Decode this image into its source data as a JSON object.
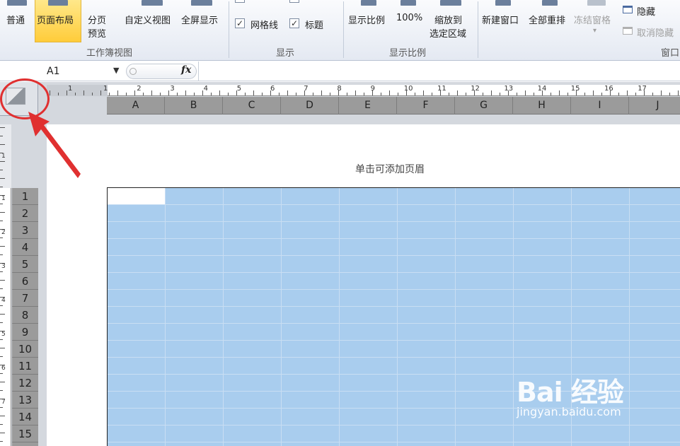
{
  "ribbon": {
    "view_group": {
      "normal": "普通",
      "page_layout": "页面布局",
      "page_break_line1": "分页",
      "page_break_line2": "预览",
      "custom_view": "自定义视图",
      "full_screen": "全屏显示",
      "label": "工作簿视图"
    },
    "show_group": {
      "gridlines": "网格线",
      "gridlines_checked": true,
      "headings": "标题",
      "headings_checked": true,
      "label": "显示"
    },
    "zoom_group": {
      "zoom": "显示比例",
      "zoom_100": "100%",
      "zoom_to_selection_line1": "缩放到",
      "zoom_to_selection_line2": "选定区域",
      "label": "显示比例"
    },
    "window_group": {
      "new_window": "新建窗口",
      "arrange_all": "全部重排",
      "freeze_panes": "冻结窗格",
      "hide": "隐藏",
      "unhide": "取消隐藏",
      "label": "窗口"
    }
  },
  "formula_bar": {
    "name_box": "A1",
    "fx": "fx",
    "formula": ""
  },
  "sheet": {
    "header_hint": "单击可添加页眉",
    "columns": [
      "A",
      "B",
      "C",
      "D",
      "E",
      "F",
      "G",
      "H",
      "I",
      "J"
    ],
    "rows": [
      "1",
      "2",
      "3",
      "4",
      "5",
      "6",
      "7",
      "8",
      "9",
      "10",
      "11",
      "12",
      "13",
      "14",
      "15"
    ],
    "h_ruler_numbers": [
      "1",
      "1",
      "2",
      "3",
      "4",
      "5",
      "6",
      "7",
      "8",
      "9",
      "10",
      "11",
      "12",
      "13",
      "14",
      "15",
      "16",
      "17"
    ],
    "v_ruler_numbers": [
      "1",
      "1",
      "2",
      "3",
      "4",
      "5",
      "6",
      "7"
    ],
    "selection_color": "#a9cdee"
  },
  "annotation": {
    "color": "#e03030"
  },
  "watermark": {
    "logo": "Bai 经验",
    "site": "jingyan.baidu.com"
  }
}
